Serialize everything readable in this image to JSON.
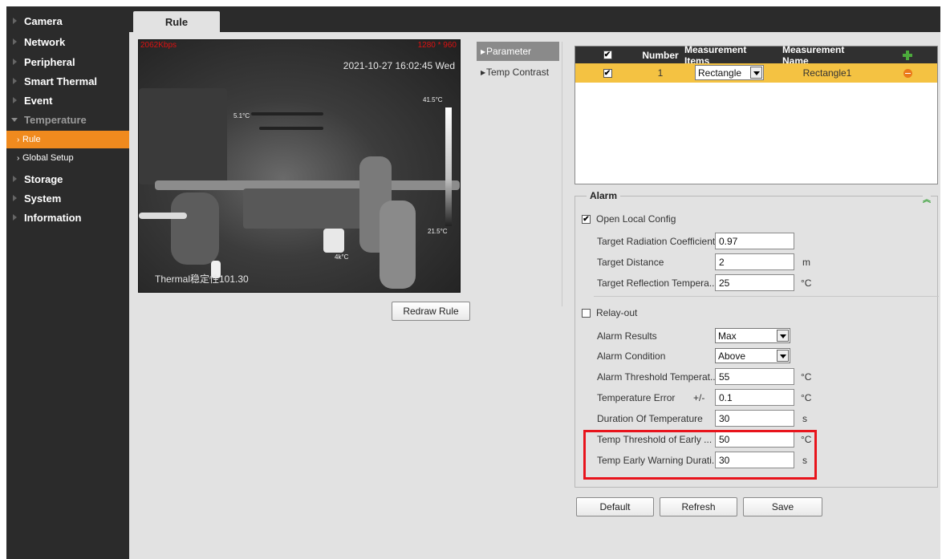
{
  "sidebar": {
    "items": [
      {
        "label": "Camera"
      },
      {
        "label": "Network"
      },
      {
        "label": "Peripheral"
      },
      {
        "label": "Smart Thermal"
      },
      {
        "label": "Event"
      },
      {
        "label": "Temperature"
      },
      {
        "label": "Storage"
      },
      {
        "label": "System"
      },
      {
        "label": "Information"
      }
    ],
    "sub_items": [
      {
        "label": "Rule",
        "active": true
      },
      {
        "label": "Global Setup",
        "active": false
      }
    ]
  },
  "header": {
    "tab": "Rule"
  },
  "video": {
    "bitrate": "2062Kbps",
    "resolution": "1280 * 960",
    "timestamp": "2021-10-27 16:02:45 Wed",
    "osd_text": "Thermal稳定性101.30",
    "temp_labels": [
      "5.1°C",
      "41.5°C",
      "21.5°C",
      "4k°C"
    ]
  },
  "buttons": {
    "redraw": "Redraw Rule",
    "default": "Default",
    "refresh": "Refresh",
    "save": "Save"
  },
  "subnav": [
    {
      "label": "Parameter",
      "active": true
    },
    {
      "label": "Temp Contrast",
      "active": false
    }
  ],
  "table": {
    "headers": {
      "number": "Number",
      "items": "Measurement Items",
      "name": "Measurement Name"
    },
    "rows": [
      {
        "checked": "✔",
        "number": "1",
        "item": "Rectangle",
        "name": "Rectangle1"
      }
    ]
  },
  "alarm": {
    "title": "Alarm",
    "open_local_config": "Open Local Config",
    "fields": [
      {
        "label": "Target Radiation Coefficient",
        "value": "0.97",
        "unit": ""
      },
      {
        "label": "Target Distance",
        "value": "2",
        "unit": "m"
      },
      {
        "label": "Target Reflection Tempera...",
        "value": "25",
        "unit": "°C"
      }
    ],
    "relay_out": "Relay-out",
    "alarm_results_label": "Alarm Results",
    "alarm_results_value": "Max",
    "alarm_condition_label": "Alarm Condition",
    "alarm_condition_value": "Above",
    "thresholds": [
      {
        "label": "Alarm Threshold Temperat...",
        "value": "55",
        "unit": "°C"
      },
      {
        "label": "Temperature Error",
        "prefix": "+/-",
        "value": "0.1",
        "unit": "°C"
      },
      {
        "label": "Duration Of Temperature",
        "value": "30",
        "unit": "s"
      },
      {
        "label": "Temp Threshold of Early ...",
        "value": "50",
        "unit": "°C"
      },
      {
        "label": "Temp Early Warning Durati...",
        "value": "30",
        "unit": "s"
      }
    ]
  },
  "colors": {
    "sidebar_bg": "#2b2b2b",
    "accent": "#f08a1e",
    "table_selected_row": "#f4c242",
    "highlight_border": "#e8141c"
  }
}
